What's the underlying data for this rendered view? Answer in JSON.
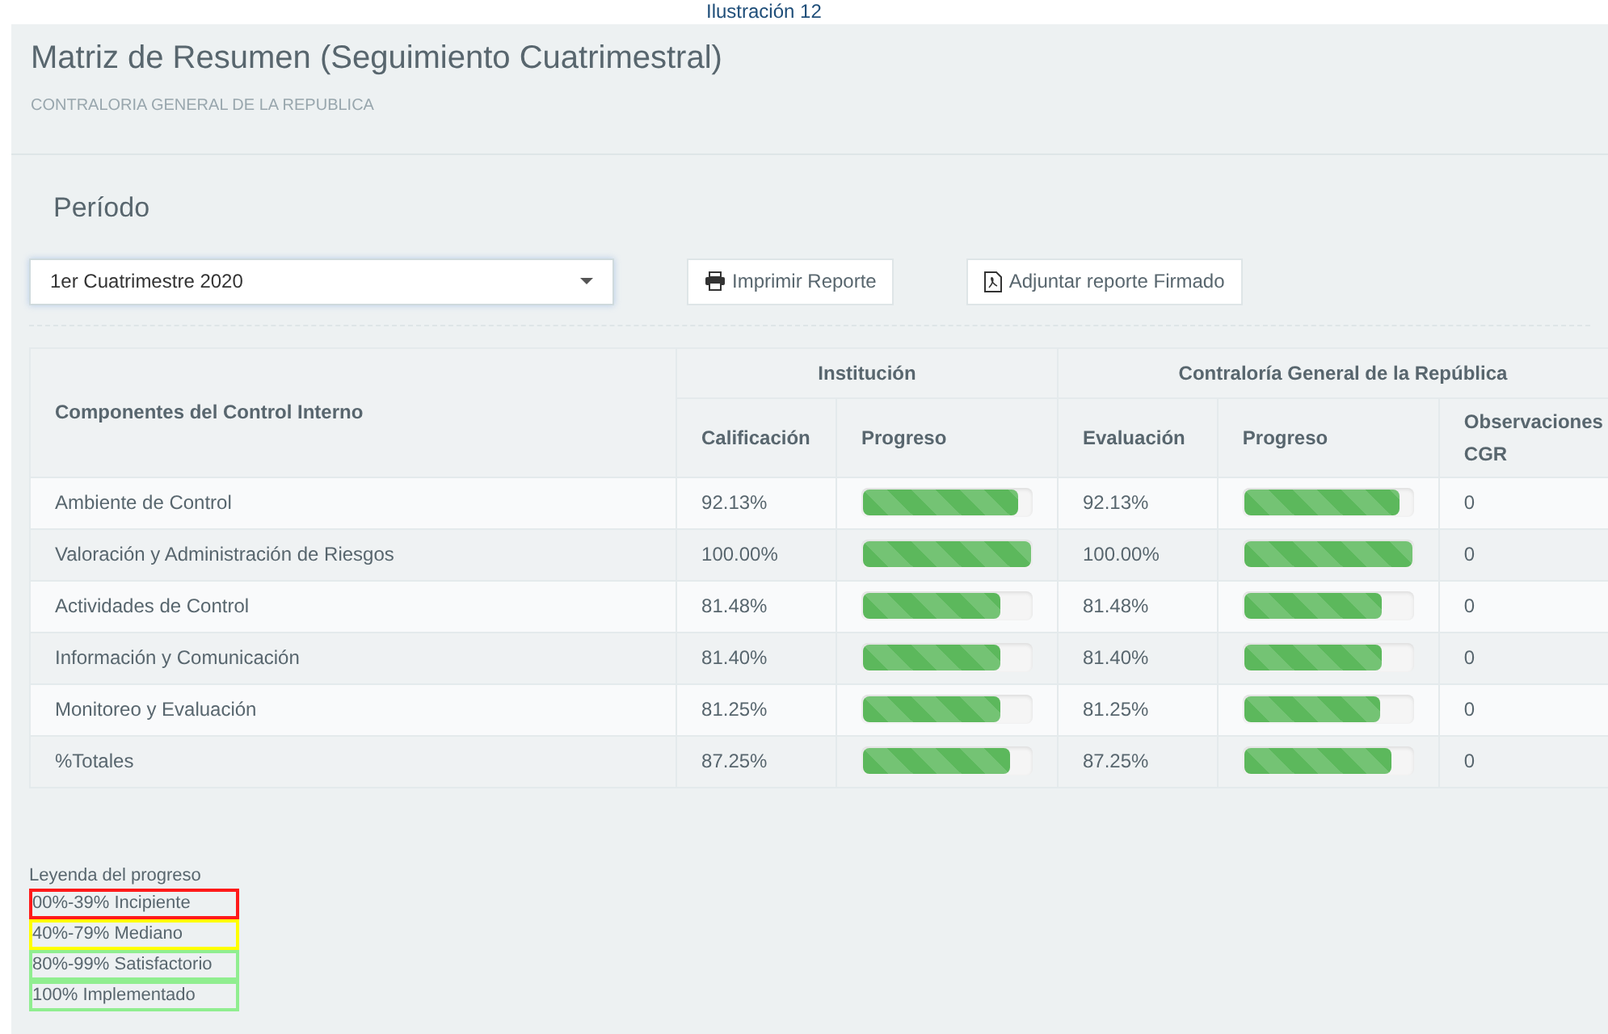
{
  "caption": "Ilustración 12",
  "header": {
    "title": "Matriz de Resumen (Seguimiento Cuatrimestral)",
    "subtitle": "CONTRALORIA GENERAL DE LA REPUBLICA"
  },
  "period": {
    "label": "Período",
    "select_value": "1er Cuatrimestre 2020"
  },
  "buttons": [
    {
      "label": "Imprimir Reporte",
      "kind": "print"
    },
    {
      "label": "Adjuntar reporte Firmado",
      "kind": "pdf"
    }
  ],
  "table": {
    "component_header": "Componentes del Control Interno",
    "groups": [
      "Institución",
      "Contraloría General de la República"
    ],
    "columns": [
      "Calificación",
      "Progreso",
      "Evaluación",
      "Progreso",
      "Observaciones CGR"
    ],
    "rows": [
      {
        "name": "Ambiente de Control",
        "institucion": {
          "value": "92.13%",
          "level": 0.9213
        },
        "cgr": {
          "value": "92.13%",
          "level": 0.9213
        },
        "observaciones": "0"
      },
      {
        "name": "Valoración y Administración de Riesgos",
        "institucion": {
          "value": "100.00%",
          "level": 1
        },
        "cgr": {
          "value": "100.00%",
          "level": 1
        },
        "observaciones": "0"
      },
      {
        "name": "Actividades de Control",
        "institucion": {
          "value": "81.48%",
          "level": 0.8148
        },
        "cgr": {
          "value": "81.48%",
          "level": 0.8148
        },
        "observaciones": "0"
      },
      {
        "name": "Información y Comunicación",
        "institucion": {
          "value": "81.40%",
          "level": 0.814
        },
        "cgr": {
          "value": "81.40%",
          "level": 0.814
        },
        "observaciones": "0"
      },
      {
        "name": "Monitoreo y Evaluación",
        "institucion": {
          "value": "81.25%",
          "level": 0.8125
        },
        "cgr": {
          "value": "81.25%",
          "level": 0.8125
        },
        "observaciones": "0"
      },
      {
        "name": "%Totales",
        "institucion": {
          "value": "87.25%",
          "level": 0.8725
        },
        "cgr": {
          "value": "87.25%",
          "level": 0.8725
        },
        "observaciones": "0"
      }
    ]
  },
  "legend": {
    "title": "Leyenda del progreso",
    "items": [
      {
        "label": "00%-39% Incipiente",
        "color": "#ff1a1a"
      },
      {
        "label": "40%-79% Mediano",
        "color": "#ffff00"
      },
      {
        "label": "80%-99% Satisfactorio",
        "color": "#90ee90"
      },
      {
        "label": "100% Implementado",
        "color": "#90ee90"
      }
    ]
  }
}
